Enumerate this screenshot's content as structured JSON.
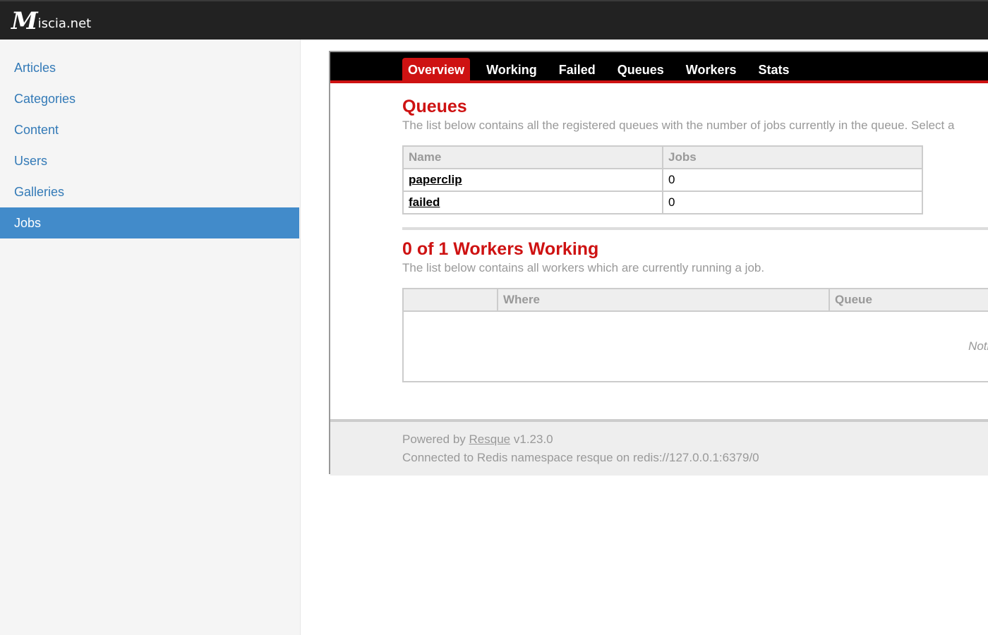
{
  "brand": {
    "logo_letter": "M",
    "name": "iscia.net"
  },
  "sidebar": {
    "items": [
      {
        "label": "Articles"
      },
      {
        "label": "Categories"
      },
      {
        "label": "Content"
      },
      {
        "label": "Users"
      },
      {
        "label": "Galleries"
      },
      {
        "label": "Jobs",
        "active": true
      }
    ]
  },
  "resque": {
    "tabs": [
      {
        "label": "Overview",
        "active": true
      },
      {
        "label": "Working"
      },
      {
        "label": "Failed"
      },
      {
        "label": "Queues"
      },
      {
        "label": "Workers"
      },
      {
        "label": "Stats"
      }
    ],
    "queues": {
      "title": "Queues",
      "subtitle": "The list below contains all the registered queues with the number of jobs currently in the queue. Select a",
      "columns": [
        "Name",
        "Jobs"
      ],
      "rows": [
        {
          "name": "paperclip",
          "jobs": "0"
        },
        {
          "name": "failed",
          "jobs": "0"
        }
      ]
    },
    "workers": {
      "title": "0 of 1 Workers Working",
      "subtitle": "The list below contains all workers which are currently running a job.",
      "columns": [
        "",
        "Where",
        "Queue"
      ],
      "empty_text": "Noth"
    },
    "footer": {
      "powered_prefix": "Powered by",
      "powered_link": "Resque",
      "version": "v1.23.0",
      "connection": "Connected to Redis namespace resque on redis://127.0.0.1:6379/0"
    }
  },
  "colors": {
    "accent": "#ce1212",
    "sidebar_active": "#428bca",
    "link": "#337ab7",
    "navbar": "#222222"
  }
}
